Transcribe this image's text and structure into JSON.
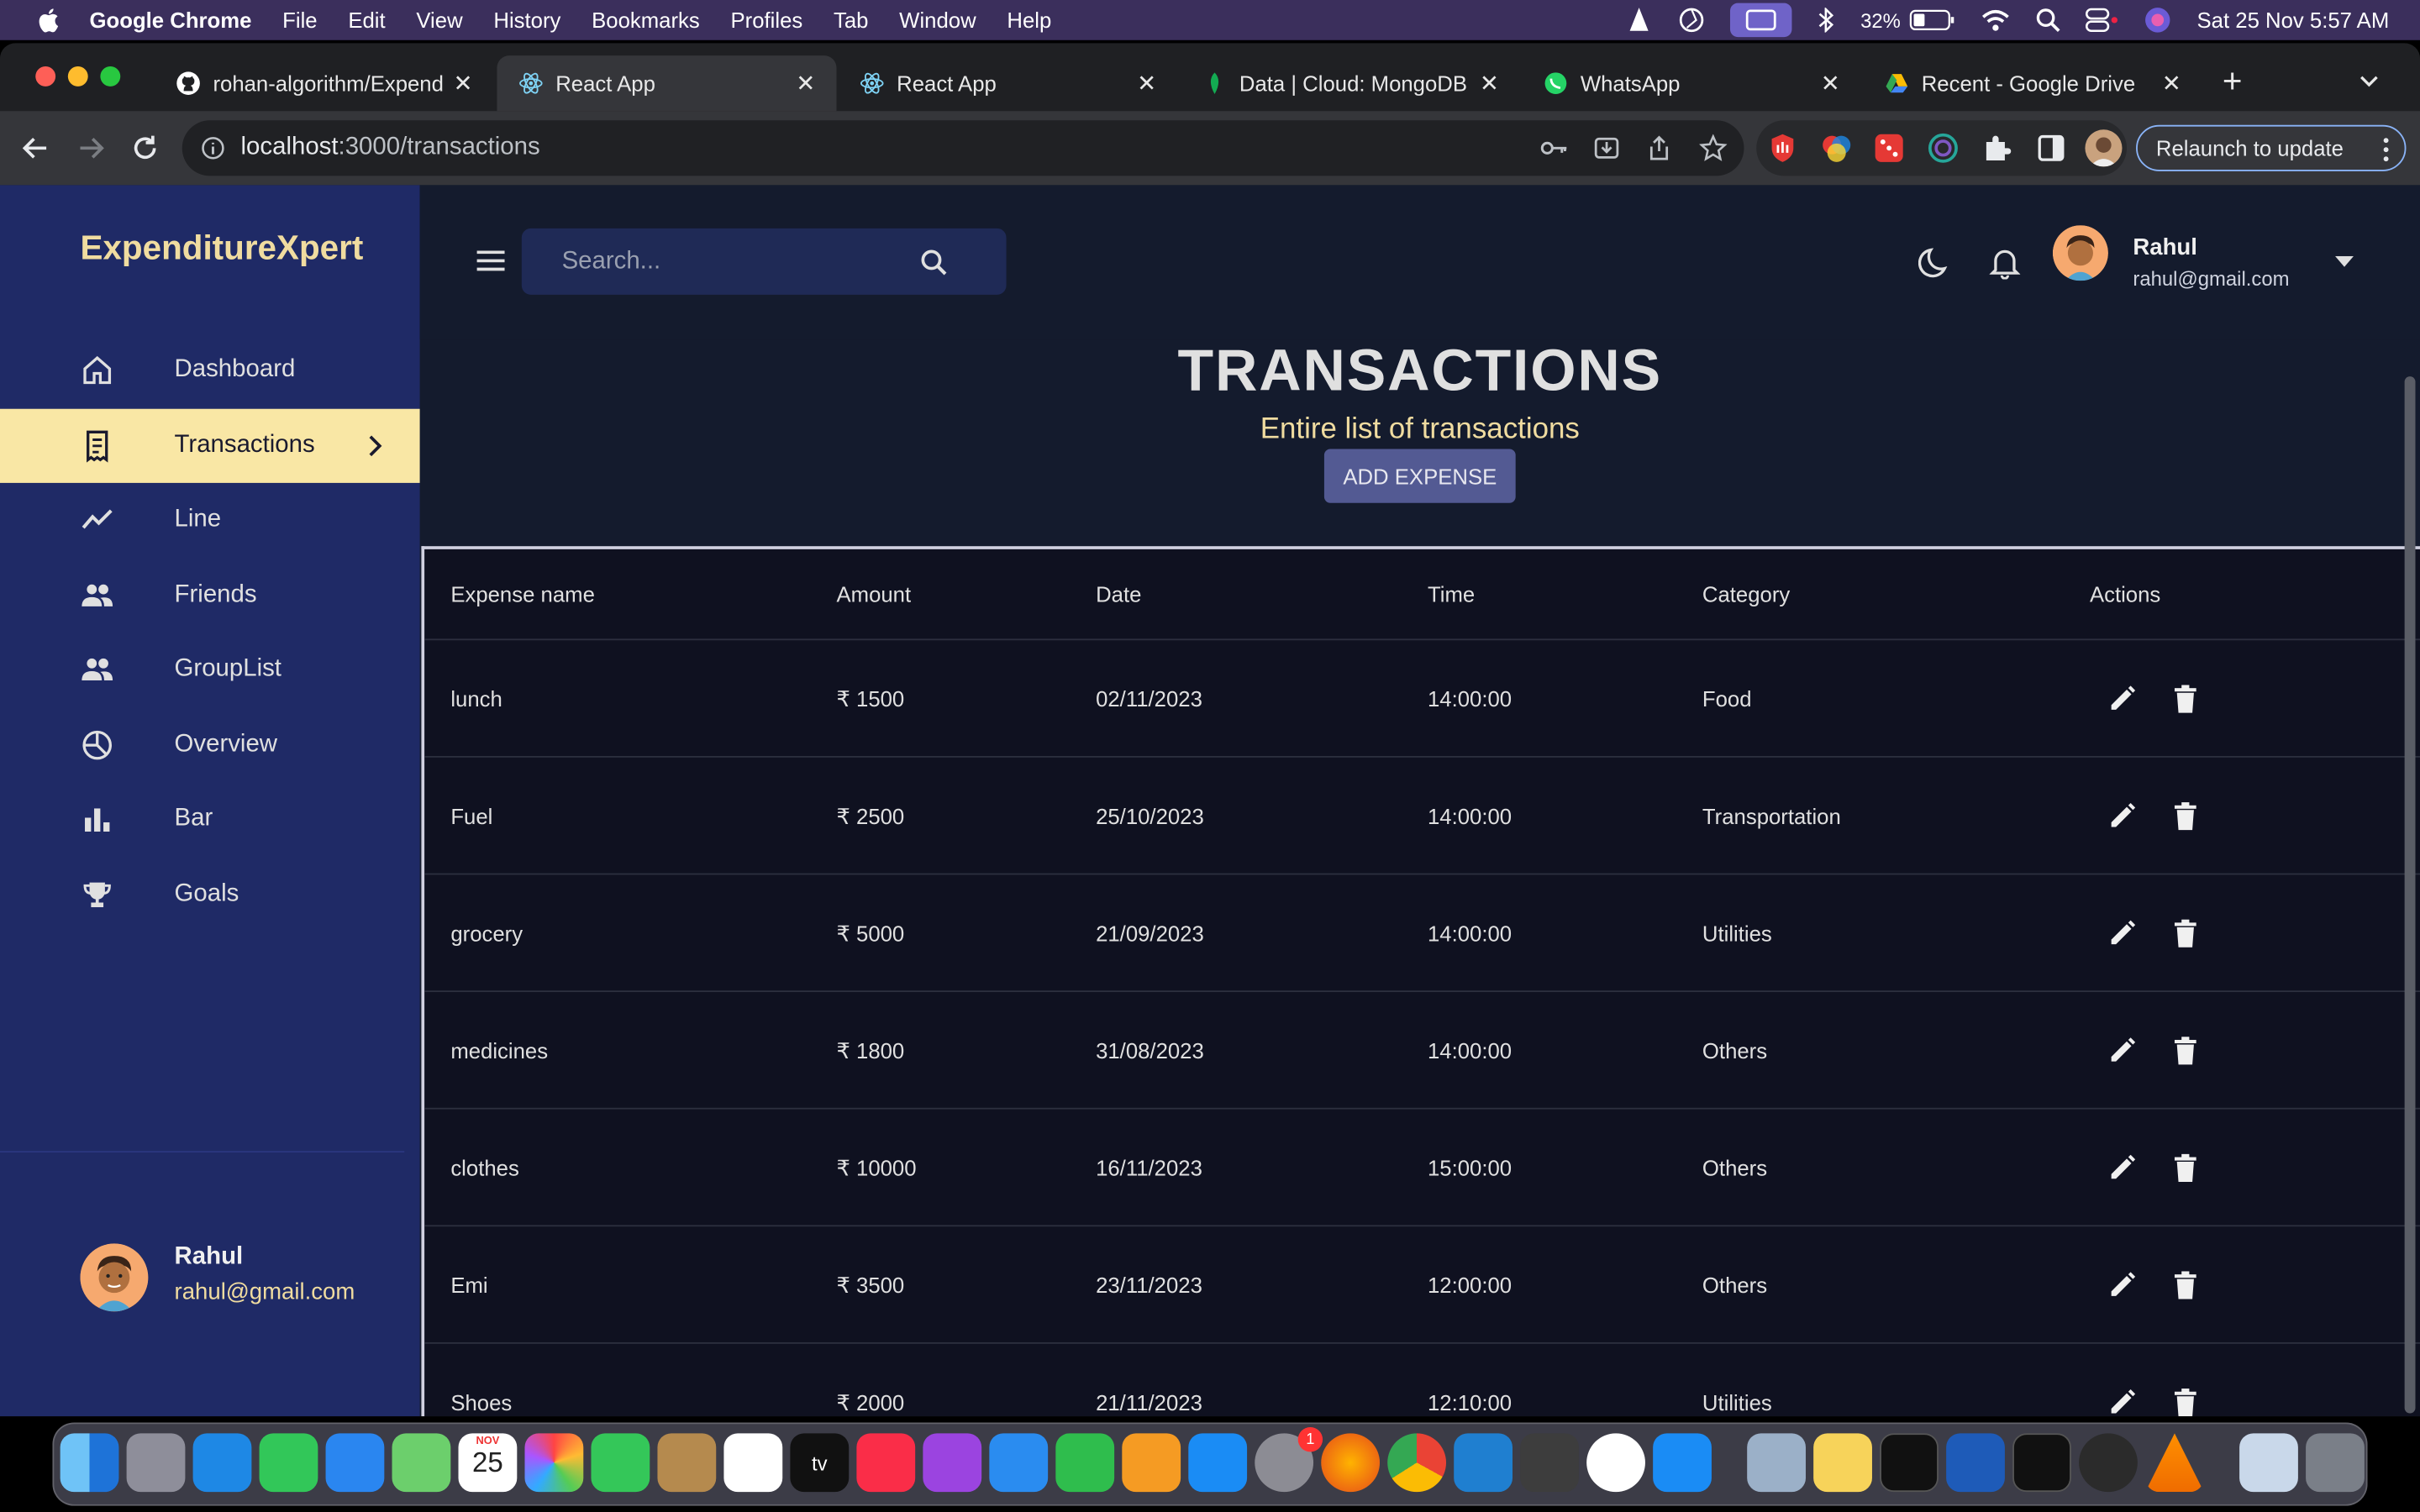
{
  "menubar": {
    "app_name": "Google Chrome",
    "items": [
      "File",
      "Edit",
      "View",
      "History",
      "Bookmarks",
      "Profiles",
      "Tab",
      "Window",
      "Help"
    ],
    "battery": "32%",
    "datetime": "Sat 25 Nov  5:57 AM"
  },
  "browser": {
    "tabs": [
      {
        "title": "rohan-algorithm/Expend",
        "icon": "github-icon",
        "active": false
      },
      {
        "title": "React App",
        "icon": "react-icon",
        "active": true
      },
      {
        "title": "React App",
        "icon": "react-icon",
        "active": false
      },
      {
        "title": "Data | Cloud: MongoDB",
        "icon": "mongodb-leaf-icon",
        "active": false
      },
      {
        "title": "WhatsApp",
        "icon": "whatsapp-icon",
        "active": false
      },
      {
        "title": "Recent - Google Drive",
        "icon": "google-drive-icon",
        "active": false
      }
    ],
    "url_host": "localhost",
    "url_rest": ":3000/transactions",
    "relaunch_label": "Relaunch to update"
  },
  "app": {
    "brand": "ExpenditureXpert",
    "search_placeholder": "Search...",
    "nav": [
      {
        "label": "Dashboard",
        "icon": "home-icon"
      },
      {
        "label": "Transactions",
        "icon": "receipt-icon",
        "active": true
      },
      {
        "label": "Line",
        "icon": "line-chart-icon"
      },
      {
        "label": "Friends",
        "icon": "people-icon"
      },
      {
        "label": "GroupList",
        "icon": "group-icon"
      },
      {
        "label": "Overview",
        "icon": "pie-chart-icon"
      },
      {
        "label": "Bar",
        "icon": "bar-chart-icon"
      },
      {
        "label": "Goals",
        "icon": "trophy-icon"
      }
    ],
    "user": {
      "name": "Rahul",
      "email": "rahul@gmail.com"
    },
    "page_title": "TRANSACTIONS",
    "page_subtitle": "Entire list of transactions",
    "add_button": "ADD EXPENSE",
    "table": {
      "headers": [
        "Expense name",
        "Amount",
        "Date",
        "Time",
        "Category",
        "Actions"
      ],
      "rows": [
        {
          "name": "lunch",
          "amount": "₹ 1500",
          "date": "02/11/2023",
          "time": "14:00:00",
          "category": "Food"
        },
        {
          "name": "Fuel",
          "amount": "₹ 2500",
          "date": "25/10/2023",
          "time": "14:00:00",
          "category": "Transportation"
        },
        {
          "name": "grocery",
          "amount": "₹ 5000",
          "date": "21/09/2023",
          "time": "14:00:00",
          "category": "Utilities"
        },
        {
          "name": "medicines",
          "amount": "₹ 1800",
          "date": "31/08/2023",
          "time": "14:00:00",
          "category": "Others"
        },
        {
          "name": "clothes",
          "amount": "₹ 10000",
          "date": "16/11/2023",
          "time": "15:00:00",
          "category": "Others"
        },
        {
          "name": "Emi",
          "amount": "₹ 3500",
          "date": "23/11/2023",
          "time": "12:00:00",
          "category": "Others"
        },
        {
          "name": "Shoes",
          "amount": "₹ 2000",
          "date": "21/11/2023",
          "time": "12:10:00",
          "category": "Utilities"
        }
      ]
    }
  },
  "dock": {
    "calendar_month": "NOV",
    "calendar_day": "25",
    "badge": "1"
  }
}
